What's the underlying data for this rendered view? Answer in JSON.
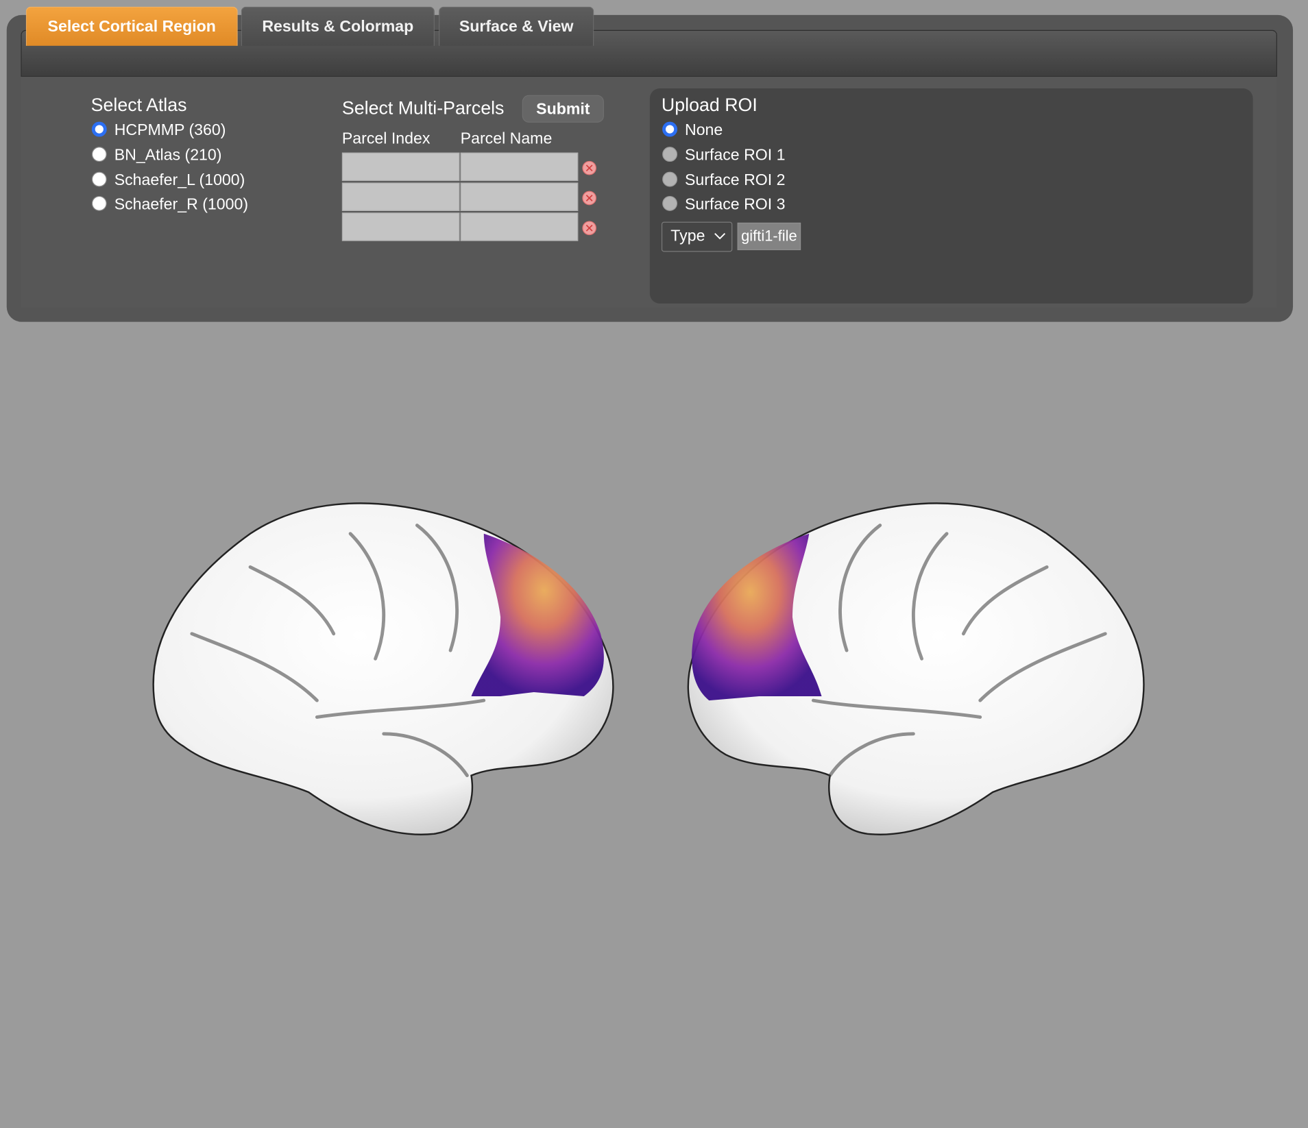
{
  "tabs": [
    {
      "label": "Select Cortical Region",
      "active": true
    },
    {
      "label": "Results & Colormap",
      "active": false
    },
    {
      "label": "Surface & View",
      "active": false
    }
  ],
  "atlas": {
    "title": "Select Atlas",
    "options": [
      {
        "label": "HCPMMP (360)",
        "selected": true
      },
      {
        "label": "BN_Atlas (210)",
        "selected": false
      },
      {
        "label": "Schaefer_L (1000)",
        "selected": false
      },
      {
        "label": "Schaefer_R (1000)",
        "selected": false
      }
    ]
  },
  "multi_parcels": {
    "title": "Select Multi-Parcels",
    "submit_label": "Submit",
    "col_index": "Parcel Index",
    "col_name": "Parcel Name",
    "rows": [
      {
        "index": "",
        "name": ""
      },
      {
        "index": "",
        "name": ""
      },
      {
        "index": "",
        "name": ""
      }
    ]
  },
  "upload_roi": {
    "title": "Upload ROI",
    "options": [
      {
        "label": "None",
        "selected": true
      },
      {
        "label": "Surface ROI 1",
        "selected": false
      },
      {
        "label": "Surface ROI 2",
        "selected": false
      },
      {
        "label": "Surface ROI 3",
        "selected": false
      }
    ],
    "type_select": "Type",
    "file_button": "gifti1-file"
  },
  "colors": {
    "accent": "#e8912c",
    "background": "#9b9b9b",
    "panel": "#575757",
    "radio_selected": "#2c6ff2",
    "delete_icon": "#f0a0a0"
  },
  "icons": {
    "delete": "close-circle-icon",
    "dropdown": "chevron-down-icon"
  }
}
